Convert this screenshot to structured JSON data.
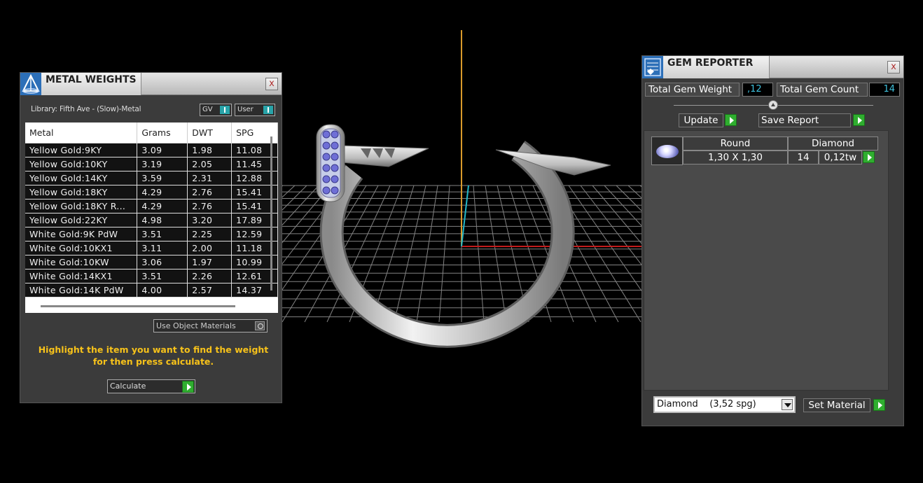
{
  "metal_weights": {
    "title": "METAL WEIGHTS",
    "close_label": "x",
    "library_label": "Library: Fifth Ave - (Slow)-Metal",
    "gv_label": "GV",
    "user_label": "User",
    "columns": [
      "Metal",
      "Grams",
      "DWT",
      "SPG"
    ],
    "rows": [
      [
        "Yellow Gold:9KY",
        "3.09",
        "1.98",
        "11.08"
      ],
      [
        "Yellow Gold:10KY",
        "3.19",
        "2.05",
        "11.45"
      ],
      [
        "Yellow Gold:14KY",
        "3.59",
        "2.31",
        "12.88"
      ],
      [
        "Yellow Gold:18KY",
        "4.29",
        "2.76",
        "15.41"
      ],
      [
        "Yellow Gold:18KY R...",
        "4.29",
        "2.76",
        "15.41"
      ],
      [
        "Yellow Gold:22KY",
        "4.98",
        "3.20",
        "17.89"
      ],
      [
        "White Gold:9K PdW",
        "3.51",
        "2.25",
        "12.59"
      ],
      [
        "White Gold:10KX1",
        "3.11",
        "2.00",
        "11.18"
      ],
      [
        "White Gold:10KW",
        "3.06",
        "1.97",
        "10.99"
      ],
      [
        "White Gold:14KX1",
        "3.51",
        "2.26",
        "12.61"
      ],
      [
        "White Gold:14K PdW",
        "4.00",
        "2.57",
        "14.37"
      ]
    ],
    "use_object_materials": "Use Object Materials",
    "hint": "Highlight the item you want to find the weight for then press calculate.",
    "calculate_label": "Calculate"
  },
  "gem_reporter": {
    "title": "GEM REPORTER",
    "close_label": "x",
    "total_weight_label": "Total Gem Weight",
    "total_weight_value": ",12",
    "total_count_label": "Total Gem Count",
    "total_count_value": "14",
    "update_label": "Update",
    "save_report_label": "Save Report",
    "gems": [
      {
        "shape": "Round",
        "size": "1,30 X 1,30",
        "material": "Diamond",
        "count": "14",
        "weight": "0,12tw",
        "icon": "round-gem-icon"
      }
    ],
    "material_select_value": "Diamond    (3,52 spg)",
    "set_material_label": "Set Material"
  },
  "colors": {
    "panel_bg": "#3b3b3b",
    "accent_green": "#2fae2f",
    "value_cyan": "#3fc0dc",
    "hint_yellow": "#f7c21a",
    "axis_red": "#c21c1c",
    "axis_orange": "#d99a2b",
    "axis_cyan": "#22b8c8"
  }
}
